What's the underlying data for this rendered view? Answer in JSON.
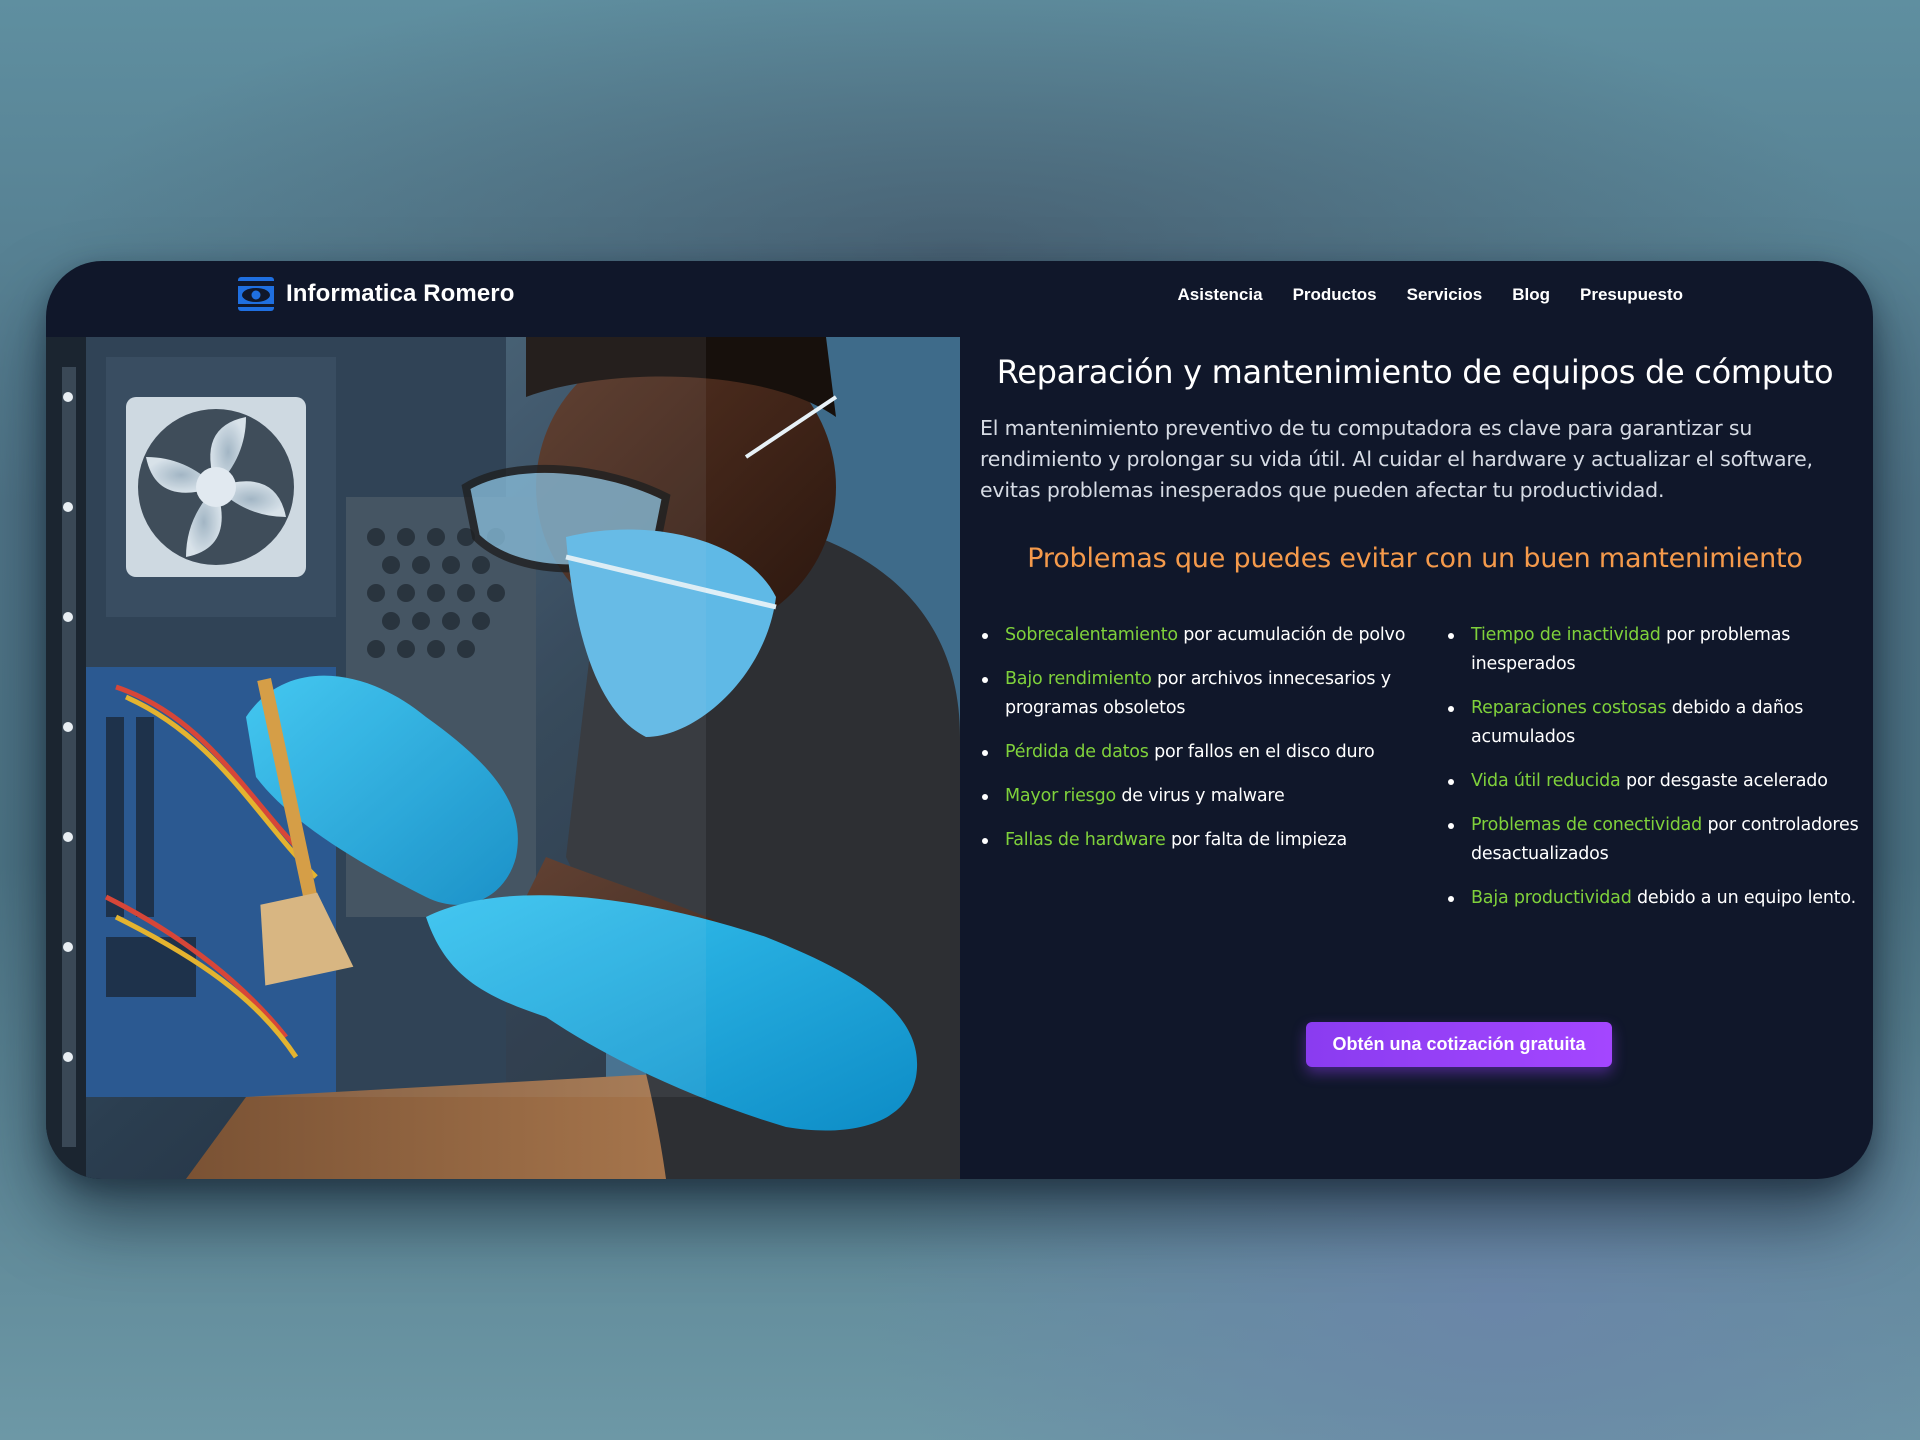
{
  "brand": {
    "name": "Informatica Romero",
    "logo_icon": "eye-logo-icon",
    "logo_color": "#1f6fe0"
  },
  "nav": {
    "items": [
      {
        "label": "Asistencia"
      },
      {
        "label": "Productos"
      },
      {
        "label": "Servicios"
      },
      {
        "label": "Blog"
      },
      {
        "label": "Presupuesto"
      }
    ]
  },
  "hero": {
    "image": "technician-cleaning-computer-photo",
    "title": "Reparación y mantenimiento de equipos de cómputo",
    "intro": "El mantenimiento preventivo de tu computadora es clave para garantizar su rendimiento y prolongar su vida útil. Al cuidar el hardware y actualizar el software, evitas problemas inesperados que pueden afectar tu productividad.",
    "subtitle": "Problemas que puedes evitar con un buen mantenimiento"
  },
  "problems": {
    "left": [
      {
        "highlight": "Sobrecalentamiento",
        "rest": " por acumulación de polvo"
      },
      {
        "highlight": "Bajo rendimiento",
        "rest": " por archivos innecesarios y programas obsoletos"
      },
      {
        "highlight": "Pérdida de datos",
        "rest": " por fallos en el disco duro"
      },
      {
        "highlight": "Mayor riesgo",
        "rest": " de virus y malware"
      },
      {
        "highlight": "Fallas de hardware",
        "rest": " por falta de limpieza"
      }
    ],
    "right": [
      {
        "highlight": "Tiempo de inactividad",
        "rest": " por problemas inesperados"
      },
      {
        "highlight": "Reparaciones costosas",
        "rest": " debido a daños acumulados"
      },
      {
        "highlight": "Vida útil reducida",
        "rest": " por desgaste acelerado"
      },
      {
        "highlight": "Problemas de conectividad",
        "rest": " por controladores desactualizados"
      },
      {
        "highlight": "Baja productividad",
        "rest": " debido a un equipo lento."
      }
    ]
  },
  "cta": {
    "label": "Obtén una cotización gratuita"
  },
  "colors": {
    "card_bg": "#10172a",
    "highlight": "#7fd13b",
    "subtitle": "#f59a4b",
    "cta": "#9b42f8"
  }
}
